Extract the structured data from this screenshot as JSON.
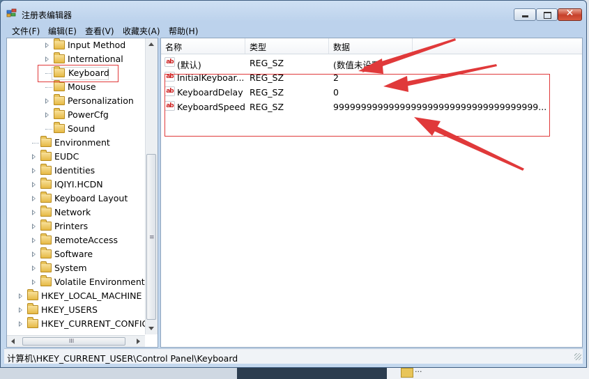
{
  "window": {
    "title": "注册表编辑器",
    "controls": {
      "minimize": "–",
      "maximize": "□",
      "close": "✕"
    }
  },
  "menubar": {
    "items": [
      {
        "label": "文件(F)"
      },
      {
        "label": "编辑(E)"
      },
      {
        "label": "查看(V)"
      },
      {
        "label": "收藏夹(A)"
      },
      {
        "label": "帮助(H)"
      }
    ]
  },
  "tree": {
    "items": [
      {
        "label": "Input Method",
        "expandable": true
      },
      {
        "label": "International",
        "expandable": true
      },
      {
        "label": "Keyboard",
        "expandable": false,
        "selected": true
      },
      {
        "label": "Mouse",
        "expandable": false
      },
      {
        "label": "Personalization",
        "expandable": true
      },
      {
        "label": "PowerCfg",
        "expandable": true
      },
      {
        "label": "Sound",
        "expandable": false
      },
      {
        "label": "Environment",
        "expandable": false
      },
      {
        "label": "EUDC",
        "expandable": true
      },
      {
        "label": "Identities",
        "expandable": true
      },
      {
        "label": "IQIYI.HCDN",
        "expandable": true
      },
      {
        "label": "Keyboard Layout",
        "expandable": true
      },
      {
        "label": "Network",
        "expandable": true
      },
      {
        "label": "Printers",
        "expandable": true
      },
      {
        "label": "RemoteAccess",
        "expandable": true
      },
      {
        "label": "Software",
        "expandable": true
      },
      {
        "label": "System",
        "expandable": true
      },
      {
        "label": "Volatile Environment",
        "expandable": true
      },
      {
        "label": "HKEY_LOCAL_MACHINE",
        "expandable": true
      },
      {
        "label": "HKEY_USERS",
        "expandable": true
      },
      {
        "label": "HKEY_CURRENT_CONFIG",
        "expandable": true
      }
    ]
  },
  "list": {
    "columns": [
      "名称",
      "类型",
      "数据"
    ],
    "rows": [
      {
        "name": "(默认)",
        "type": "REG_SZ",
        "data": "(数值未设置)"
      },
      {
        "name": "InitialKeyboar...",
        "type": "REG_SZ",
        "data": "2"
      },
      {
        "name": "KeyboardDelay",
        "type": "REG_SZ",
        "data": "0"
      },
      {
        "name": "KeyboardSpeed",
        "type": "REG_SZ",
        "data": "9999999999999999999999999999999999999..."
      }
    ],
    "value_icon": "ab"
  },
  "statusbar": {
    "path": "计算机\\HKEY_CURRENT_USER\\Control Panel\\Keyboard"
  },
  "annotations": {
    "color": "#e0393a"
  },
  "background": {
    "fragment_text": "..."
  }
}
